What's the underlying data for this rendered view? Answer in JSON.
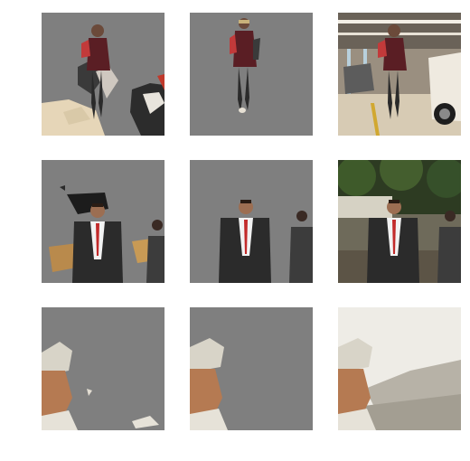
{
  "grid": {
    "rows": [
      {
        "scene": "woman-walking-parking-garage",
        "panels": [
          {
            "kind": "mask-prediction-a",
            "background": "#7f7f7f"
          },
          {
            "kind": "mask-prediction-b",
            "background": "#7f7f7f"
          },
          {
            "kind": "original-image"
          }
        ]
      },
      {
        "scene": "man-in-suit-red-tie-walking",
        "panels": [
          {
            "kind": "mask-prediction-a",
            "background": "#7f7f7f"
          },
          {
            "kind": "mask-prediction-b",
            "background": "#7f7f7f"
          },
          {
            "kind": "original-image"
          }
        ]
      },
      {
        "scene": "head-wrap-on-rocky-shore",
        "panels": [
          {
            "kind": "mask-prediction-a",
            "background": "#7f7f7f"
          },
          {
            "kind": "mask-prediction-b",
            "background": "#7f7f7f"
          },
          {
            "kind": "original-image"
          }
        ]
      }
    ]
  }
}
